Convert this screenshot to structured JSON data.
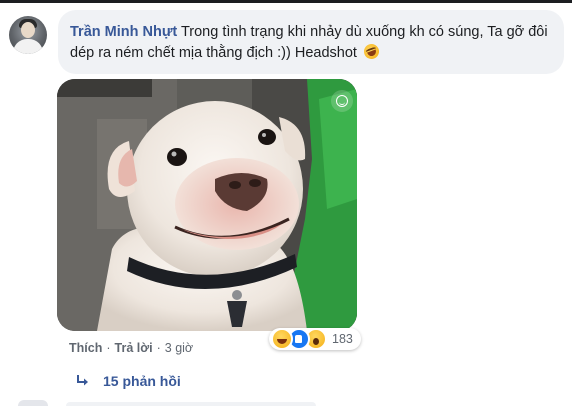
{
  "comment": {
    "author": "Trần Minh Nhựt",
    "text": "Trong tình trạng khi nhảy dù xuống kh có súng, Ta gỡ đôi dép ra ném chết mịa thằng địch :)) Headshot",
    "trailing_emoji": "laughing-emoji",
    "image": "smiling-white-dog-photo"
  },
  "actions": {
    "like_label": "Thích",
    "reply_label": "Trả lời",
    "time_label": "3 giờ",
    "separator": "·"
  },
  "reactions": {
    "types": [
      "haha",
      "like",
      "wow"
    ],
    "count": "183"
  },
  "replies": {
    "label": "15 phản hồi"
  },
  "colors": {
    "author": "#385898",
    "bubble": "#f0f2f5",
    "meta": "#606770",
    "like_blue": "#1877f2"
  }
}
